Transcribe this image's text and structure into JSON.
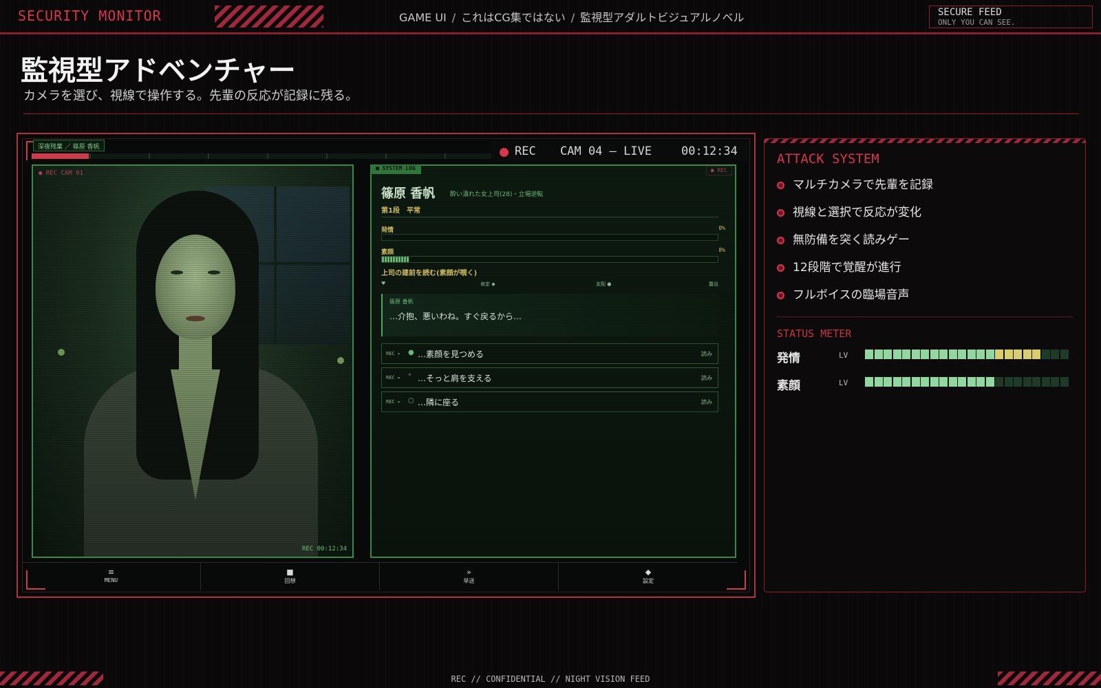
{
  "header": {
    "brand": "SECURITY MONITOR",
    "breadcrumb": [
      "GAME UI",
      "これはCG集ではない",
      "監視型アダルトビジュアルノベル"
    ],
    "secure_title": "SECURE FEED",
    "secure_sub": "ONLY YOU CAN SEE."
  },
  "hero": {
    "title": "監視型アドベンチャー",
    "subtitle": "カメラを選び、視線で操作する。先輩の反応が記録に残る。"
  },
  "game": {
    "scene_tag": "深夜残業 ／ 篠原 香帆",
    "progress_fraction": 0.12,
    "rec_label": "REC",
    "cam_label": "CAM 04 — LIVE",
    "rec_time": "00:12:34",
    "cam_rec_tag": "● REC CAM 01",
    "cam_time_tag": "REC 00:12:34",
    "syslog": {
      "tab": "■ SYSTEM LOG",
      "rec": "● REC",
      "name": "篠原 香帆",
      "desc": "酔い潰れた女上司(28)・立場逆転",
      "stage": "第1段　平常",
      "meters": [
        {
          "label": "発情",
          "pct": "0%",
          "value": 0
        },
        {
          "label": "素顔",
          "pct": "8%",
          "value": 0.08
        }
      ],
      "read_hint": "上司の建前を読む(素顔が覗く)",
      "scale": [
        "♥",
        "肯定 ◆",
        "支配 ●",
        "露出"
      ],
      "speaker": "篠原 香帆",
      "line": "…介抱、悪いわね。すぐ戻るから…",
      "choices": [
        {
          "prefix": "REC ▸",
          "icon": "●",
          "text": "…素顔を見つめる",
          "hint": "読み"
        },
        {
          "prefix": "REC ▸",
          "icon": "\"",
          "text": "…そっと肩を支える",
          "hint": "読み"
        },
        {
          "prefix": "REC ▸",
          "icon": "○",
          "text": "…隣に座る",
          "hint": "読み"
        }
      ]
    },
    "nav": [
      {
        "icon": "≡",
        "label": "MENU"
      },
      {
        "icon": "■",
        "label": "回想"
      },
      {
        "icon": "»",
        "label": "早送"
      },
      {
        "icon": "◆",
        "label": "設定"
      }
    ]
  },
  "side": {
    "title": "ATTACK SYSTEM",
    "features": [
      "マルチカメラで先輩を記録",
      "視線と選択で反応が変化",
      "無防備を突く読みゲー",
      "12段階で覚醒が進行",
      "フルボイスの臨場音声"
    ],
    "status_title": "STATUS METER",
    "stats": [
      {
        "name": "発情",
        "lv": "LV",
        "lit": 14,
        "highlight_from": 14,
        "highlight_to": 19,
        "total": 22
      },
      {
        "name": "素顔",
        "lv": "LV",
        "lit": 14,
        "highlight_from": 0,
        "highlight_to": 0,
        "total": 22
      }
    ]
  },
  "footer": "REC // CONFIDENTIAL // NIGHT VISION FEED",
  "colors": {
    "accent": "#d9364c",
    "green": "#5fc46e",
    "amber": "#d4c25a",
    "seg_on": "#8fd9a0",
    "seg_hi": "#d8cf6a",
    "seg_off": "#1e3a28"
  }
}
